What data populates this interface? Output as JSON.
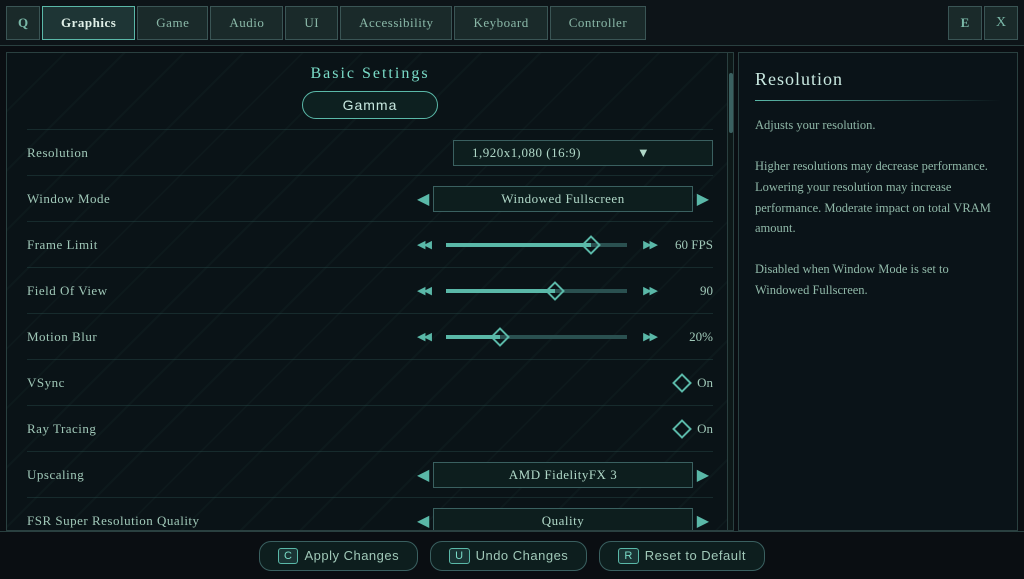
{
  "nav": {
    "left_icon": "Q",
    "right_icon": "E",
    "close_icon": "X",
    "tabs": [
      {
        "label": "Graphics",
        "active": true
      },
      {
        "label": "Game",
        "active": false
      },
      {
        "label": "Audio",
        "active": false
      },
      {
        "label": "UI",
        "active": false
      },
      {
        "label": "Accessibility",
        "active": false
      },
      {
        "label": "Keyboard",
        "active": false
      },
      {
        "label": "Controller",
        "active": false
      }
    ]
  },
  "panel": {
    "title": "Basic Settings",
    "gamma_label": "Gamma",
    "settings": [
      {
        "label": "Resolution",
        "type": "dropdown",
        "value": "1,920x1,080 (16:9)"
      },
      {
        "label": "Window Mode",
        "type": "arrow",
        "value": "Windowed Fullscreen"
      },
      {
        "label": "Frame Limit",
        "type": "slider",
        "value": "60 FPS",
        "fill_pct": 80,
        "thumb_pct": 80
      },
      {
        "label": "Field Of View",
        "type": "slider",
        "value": "90",
        "fill_pct": 60,
        "thumb_pct": 60
      },
      {
        "label": "Motion Blur",
        "type": "slider",
        "value": "20%",
        "fill_pct": 30,
        "thumb_pct": 30
      },
      {
        "label": "VSync",
        "type": "toggle",
        "value": "On"
      },
      {
        "label": "Ray Tracing",
        "type": "toggle",
        "value": "On"
      },
      {
        "label": "Upscaling",
        "type": "arrow",
        "value": "AMD FidelityFX 3"
      },
      {
        "label": "FSR Super Resolution Quality",
        "type": "arrow",
        "value": "Quality"
      }
    ]
  },
  "info_panel": {
    "title": "Resolution",
    "text": "Adjusts your resolution.\n\nHigher resolutions may decrease performance. Lowering your resolution may increase performance. Moderate impact on total VRAM amount.\n\nDisabled when Window Mode is set to Windowed Fullscreen."
  },
  "bottom": {
    "apply_key": "C",
    "apply_label": "Apply Changes",
    "undo_key": "U",
    "undo_label": "Undo Changes",
    "reset_key": "R",
    "reset_label": "Reset to Default"
  }
}
